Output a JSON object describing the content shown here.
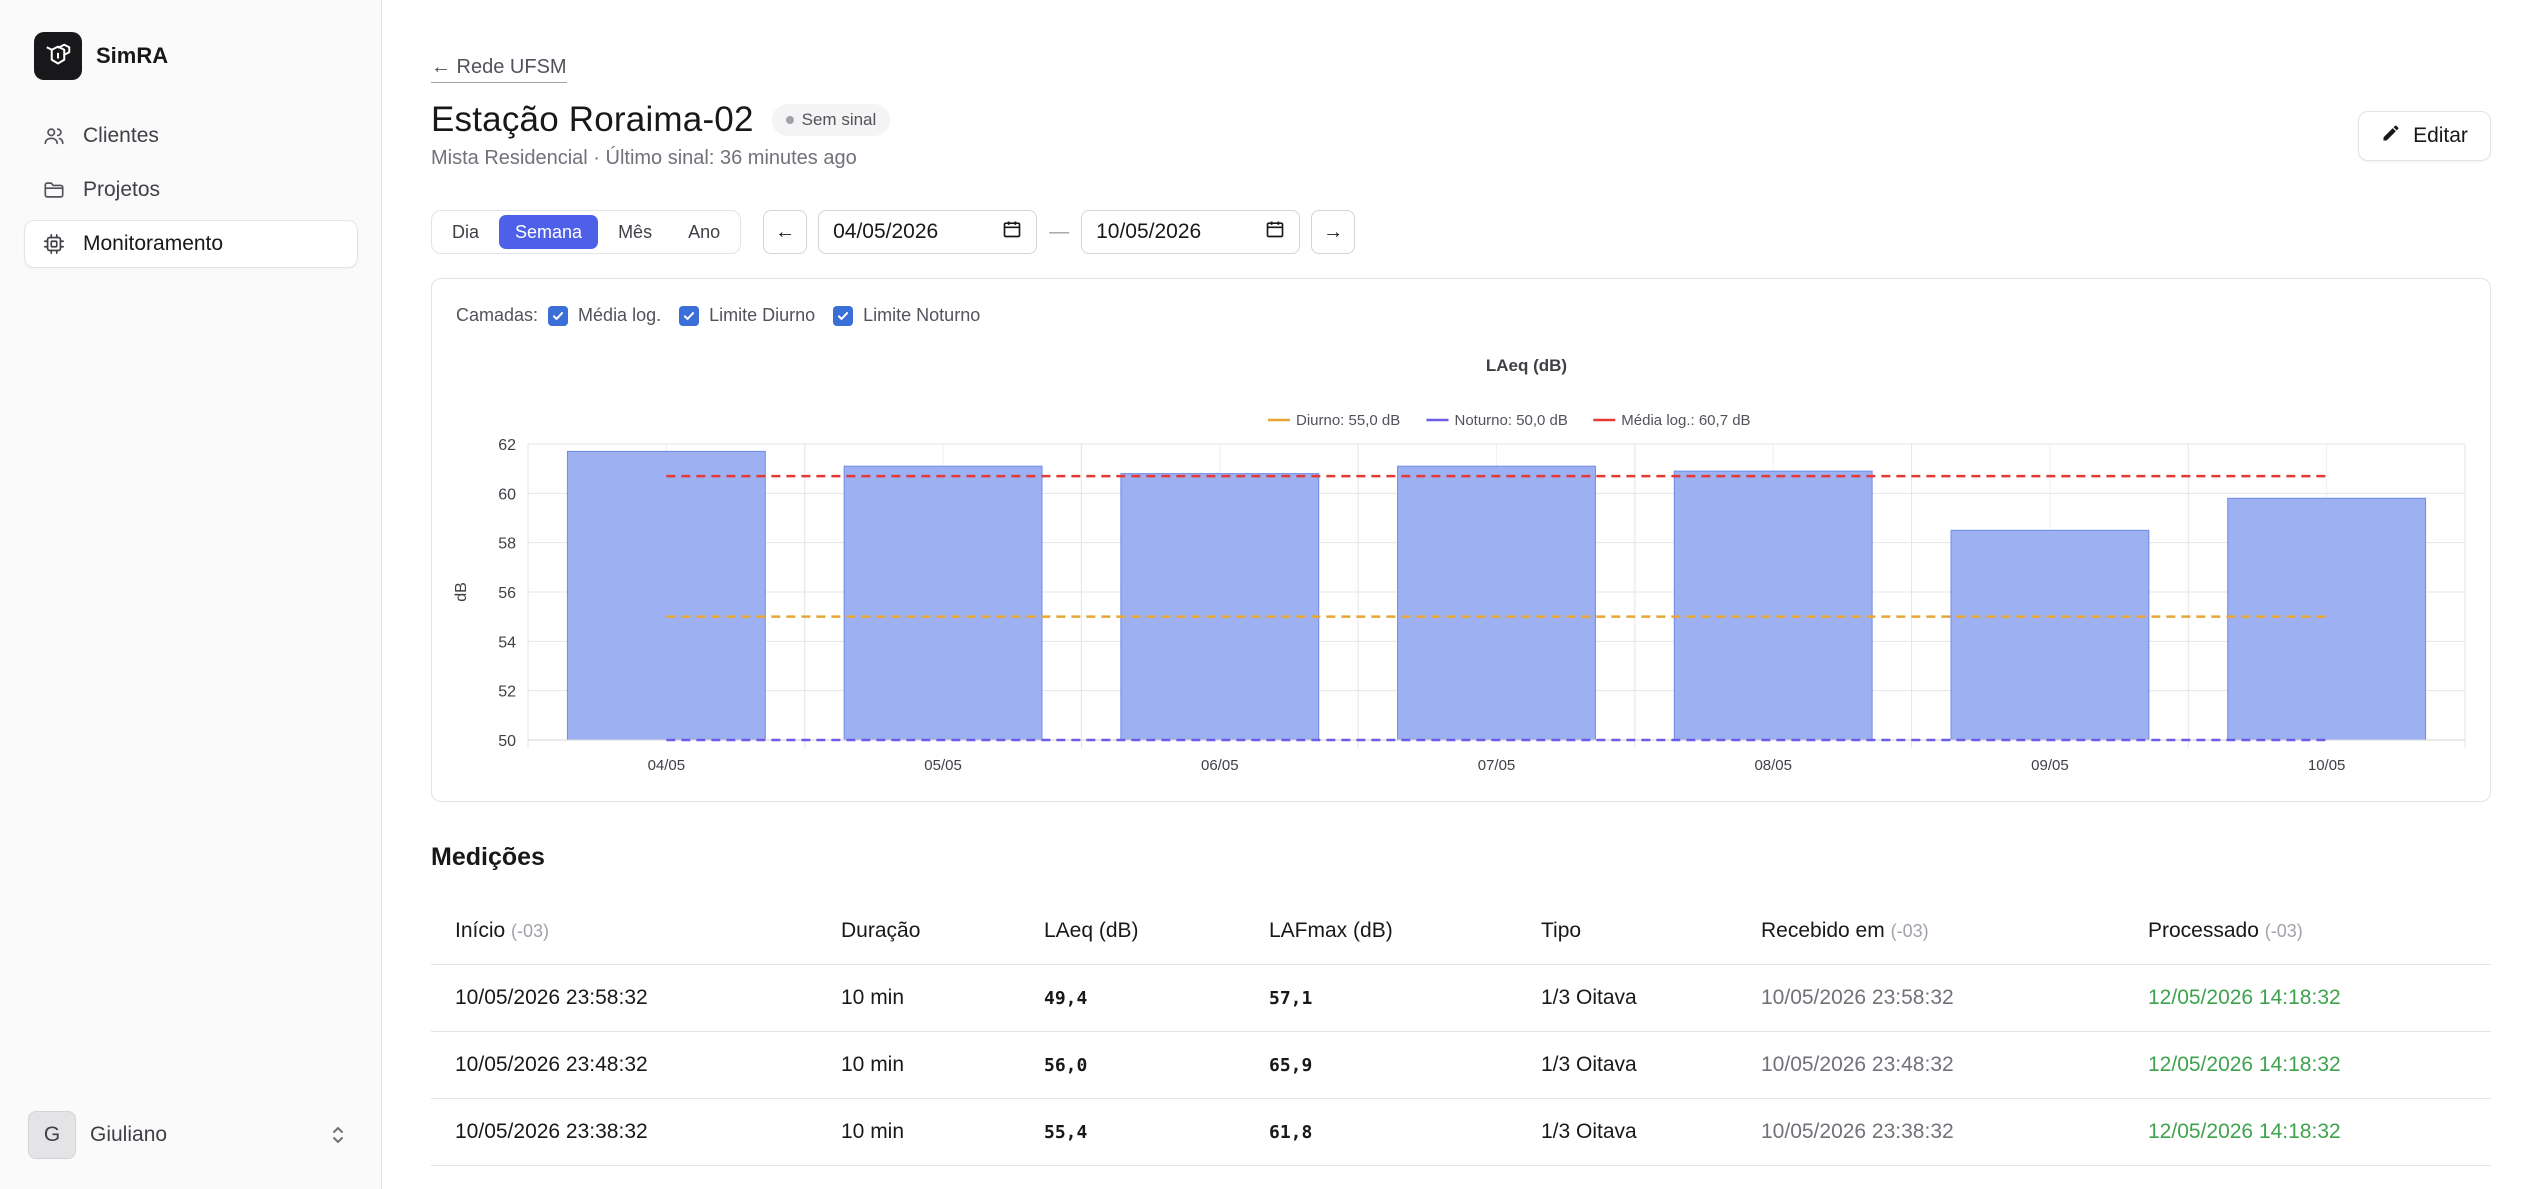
{
  "app": {
    "name": "SimRA"
  },
  "sidebar": {
    "items": [
      {
        "label": "Clientes",
        "icon": "users-icon",
        "active": false
      },
      {
        "label": "Projetos",
        "icon": "folder-icon",
        "active": false
      },
      {
        "label": "Monitoramento",
        "icon": "chip-icon",
        "active": true
      }
    ],
    "user": {
      "initial": "G",
      "name": "Giuliano"
    }
  },
  "header": {
    "back_label": "← Rede UFSM",
    "title": "Estação Roraima-02",
    "status_badge": "Sem sinal",
    "subtitle": "Mista Residencial · Último sinal: 36 minutes ago",
    "edit_label": "Editar"
  },
  "toolbar": {
    "periods": [
      "Dia",
      "Semana",
      "Mês",
      "Ano"
    ],
    "active_period": "Semana",
    "prev_label": "←",
    "next_label": "→",
    "date_from": "04/05/2026",
    "date_to": "10/05/2026",
    "separator": "—"
  },
  "layers": {
    "label": "Camadas:",
    "items": [
      "Média log.",
      "Limite Diurno",
      "Limite Noturno"
    ]
  },
  "chart_data": {
    "type": "bar",
    "title": "LAeq (dB)",
    "ylabel": "dB",
    "xlabel": "",
    "ylim": [
      50,
      62
    ],
    "yticks": [
      50,
      52,
      54,
      56,
      58,
      60,
      62
    ],
    "categories": [
      "04/05",
      "05/05",
      "06/05",
      "07/05",
      "08/05",
      "09/05",
      "10/05"
    ],
    "values": [
      61.7,
      61.1,
      60.8,
      61.1,
      60.9,
      58.5,
      59.8
    ],
    "bar_color": "#9db1f2",
    "reference_lines": [
      {
        "name": "Diurno: 55,0 dB",
        "value": 55.0,
        "color": "#e8a735"
      },
      {
        "name": "Noturno: 50,0 dB",
        "value": 50.0,
        "color": "#6d5ce8"
      },
      {
        "name": "Média log.: 60,7 dB",
        "value": 60.7,
        "color": "#e53935"
      }
    ],
    "grid": true,
    "legend_position": "top-center"
  },
  "measurements": {
    "title": "Medições",
    "columns": [
      {
        "label": "Início",
        "tz": "(-03)"
      },
      {
        "label": "Duração",
        "tz": ""
      },
      {
        "label": "LAeq (dB)",
        "tz": ""
      },
      {
        "label": "LAFmax (dB)",
        "tz": ""
      },
      {
        "label": "Tipo",
        "tz": ""
      },
      {
        "label": "Recebido em",
        "tz": "(-03)"
      },
      {
        "label": "Processado",
        "tz": "(-03)"
      }
    ],
    "rows": [
      [
        "10/05/2026 23:58:32",
        "10 min",
        "49,4",
        "57,1",
        "1/3 Oitava",
        "10/05/2026 23:58:32",
        "12/05/2026 14:18:32"
      ],
      [
        "10/05/2026 23:48:32",
        "10 min",
        "56,0",
        "65,9",
        "1/3 Oitava",
        "10/05/2026 23:48:32",
        "12/05/2026 14:18:32"
      ],
      [
        "10/05/2026 23:38:32",
        "10 min",
        "55,4",
        "61,8",
        "1/3 Oitava",
        "10/05/2026 23:38:32",
        "12/05/2026 14:18:32"
      ]
    ]
  }
}
